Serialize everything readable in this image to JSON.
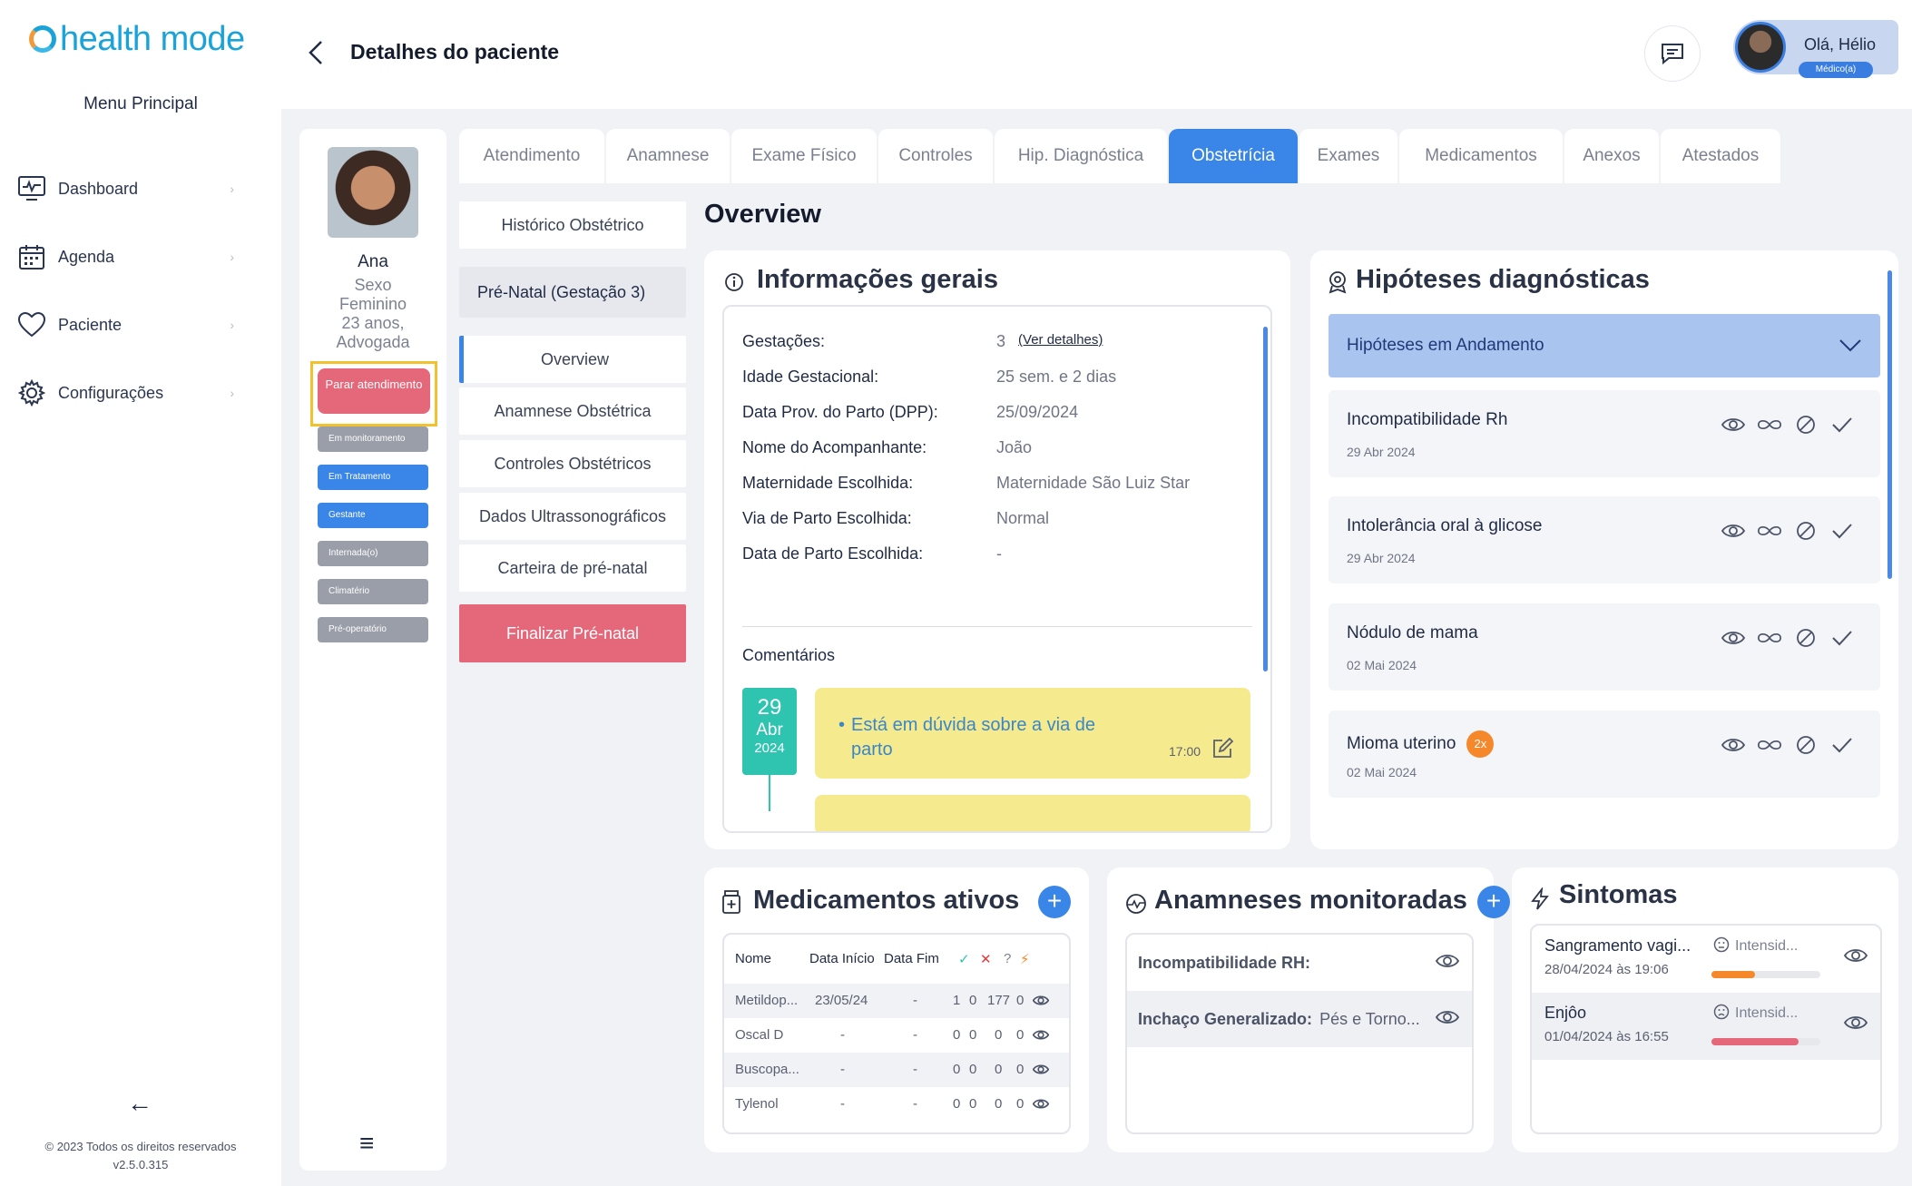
{
  "app": {
    "logo_text": "health mode",
    "menu_title": "Menu Principal"
  },
  "sidebar": {
    "items": [
      {
        "label": "Dashboard",
        "icon": "monitor-icon"
      },
      {
        "label": "Agenda",
        "icon": "calendar-icon"
      },
      {
        "label": "Paciente",
        "icon": "heart-icon"
      },
      {
        "label": "Configurações",
        "icon": "gear-icon"
      }
    ],
    "copyright": "© 2023 Todos os direitos reservados",
    "version": "v2.5.0.315"
  },
  "header": {
    "title": "Detalhes do paciente",
    "user_greeting": "Olá, Hélio",
    "user_role": "Médico(a)"
  },
  "patient": {
    "name": "Ana",
    "sex_label": "Sexo",
    "sex": "Feminino",
    "age": "23 anos,",
    "profession": "Advogada",
    "stop_button": "Parar atendimento",
    "status_tags": [
      {
        "label": "Em monitoramento",
        "color": "#9a9ea8"
      },
      {
        "label": "Em Tratamento",
        "color": "#3a86e8"
      },
      {
        "label": "Gestante",
        "color": "#3a86e8"
      },
      {
        "label": "Internada(o)",
        "color": "#9a9ea8"
      },
      {
        "label": "Climatério",
        "color": "#9a9ea8"
      },
      {
        "label": "Pré-operatório",
        "color": "#9a9ea8"
      }
    ]
  },
  "tabs": [
    "Atendimento",
    "Anamnese",
    "Exame Físico",
    "Controles",
    "Hip. Diagnóstica",
    "Obstetrícia",
    "Exames",
    "Medicamentos",
    "Anexos",
    "Atestados"
  ],
  "active_tab": "Obstetrícia",
  "submenu": {
    "historico": "Histórico Obstétrico",
    "prenatal": "Pré-Natal (Gestação 3)",
    "items": [
      "Overview",
      "Anamnese Obstétrica",
      "Controles Obstétricos",
      "Dados Ultrassonográficos",
      "Carteira de pré-natal"
    ],
    "finish": "Finalizar Pré-natal"
  },
  "overview_title": "Overview",
  "info": {
    "title": "Informações gerais",
    "rows": [
      {
        "label": "Gestações:",
        "value": "3"
      },
      {
        "label": "Idade Gestacional:",
        "value": "25 sem. e 2 dias"
      },
      {
        "label": "Data Prov. do Parto (DPP):",
        "value": "25/09/2024"
      },
      {
        "label": "Nome do Acompanhante:",
        "value": "João"
      },
      {
        "label": "Maternidade Escolhida:",
        "value": "Maternidade São Luiz Star"
      },
      {
        "label": "Via de Parto Escolhida:",
        "value": "Normal"
      },
      {
        "label": "Data de Parto Escolhida:",
        "value": "-"
      }
    ],
    "details_link": "(Ver detalhes)",
    "comments_title": "Comentários",
    "comment": {
      "day": "29",
      "month": "Abr",
      "year": "2024",
      "text": "Está em dúvida sobre a via de parto",
      "time": "17:00"
    }
  },
  "hypotheses": {
    "title": "Hipóteses diagnósticas",
    "section": "Hipóteses em Andamento",
    "items": [
      {
        "name": "Incompatibilidade Rh",
        "date": "29 Abr 2024"
      },
      {
        "name": "Intolerância oral à glicose",
        "date": "29 Abr 2024"
      },
      {
        "name": "Nódulo de mama",
        "date": "02 Mai 2024"
      },
      {
        "name": "Mioma uterino",
        "date": "02 Mai 2024",
        "badge": "2x"
      }
    ]
  },
  "medications": {
    "title": "Medicamentos ativos",
    "headers": {
      "name": "Nome",
      "start": "Data Início",
      "end": "Data Fim",
      "question": "?"
    },
    "rows": [
      {
        "name": "Metildop...",
        "start": "23/05/24",
        "end": "-",
        "c1": "1",
        "c2": "0",
        "c3": "177",
        "c4": "0"
      },
      {
        "name": "Oscal D",
        "start": "-",
        "end": "-",
        "c1": "0",
        "c2": "0",
        "c3": "0",
        "c4": "0"
      },
      {
        "name": "Buscopa...",
        "start": "-",
        "end": "-",
        "c1": "0",
        "c2": "0",
        "c3": "0",
        "c4": "0"
      },
      {
        "name": "Tylenol",
        "start": "-",
        "end": "-",
        "c1": "0",
        "c2": "0",
        "c3": "0",
        "c4": "0"
      }
    ]
  },
  "anamneses": {
    "title": "Anamneses monitoradas",
    "rows": [
      {
        "label": "Incompatibilidade RH:",
        "value": ""
      },
      {
        "label": "Inchaço Generalizado:",
        "value": "Pés e Torno..."
      }
    ]
  },
  "symptoms": {
    "title": "Sintomas",
    "items": [
      {
        "name": "Sangramento vagi...",
        "date": "28/04/2024 às 19:06",
        "intensity": "Intensid...",
        "level": 0.4,
        "color": "#f5882b"
      },
      {
        "name": "Enjôo",
        "date": "01/04/2024 às 16:55",
        "intensity": "Intensid...",
        "level": 0.8,
        "color": "#e5677a"
      }
    ]
  },
  "colors": {
    "accent": "#3a86e8",
    "danger": "#e5677a",
    "highlight": "#f2c12e",
    "teal": "#2ec4b0",
    "note": "#f6ea8f"
  }
}
